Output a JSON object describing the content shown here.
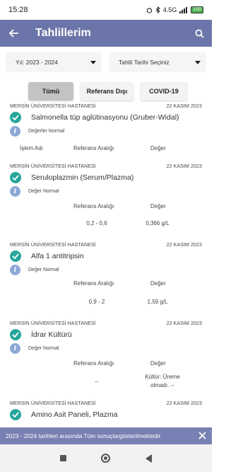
{
  "status_bar": {
    "time": "15:28",
    "network": "4.5G",
    "battery": "100"
  },
  "app_bar": {
    "title": "Tahlillerim"
  },
  "filters": {
    "year": "Yıl: 2023 - 2024",
    "date_placeholder": "Tahlil Tarihi Seçiniz"
  },
  "tabs": [
    {
      "label": "Tümü"
    },
    {
      "label": "Referans Dışı"
    },
    {
      "label": "COVID-19"
    }
  ],
  "results": [
    {
      "hospital": "MERSİN ÜNİVERSİTESİ HASTANESİ",
      "date": "22 KASIM 2023",
      "name": "Salmonella tüp aglütinasyonu (Gruber-Widal)",
      "status": "Değerler Normal",
      "col_process": "İşlem Adı",
      "col_range": "Referans Aralığı",
      "col_value": "Değer"
    },
    {
      "hospital": "MERSİN ÜNİVERSİTESİ HASTANESİ",
      "date": "22 KASIM 2023",
      "name": "Seruloplazmin (Serum/Plazma)",
      "status": "Değer Normal",
      "col_range": "Referans Aralığı",
      "col_value": "Değer",
      "range": "0,2 - 0,6",
      "value": "0,366 g/L"
    },
    {
      "hospital": "MERSİN ÜNİVERSİTESİ HASTANESİ",
      "date": "22 KASIM 2023",
      "name": "Alfa 1 antitripsin",
      "status": "Değer Normal",
      "col_range": "Referans Aralığı",
      "col_value": "Değer",
      "range": "0,9 - 2",
      "value": "1,59 g/L"
    },
    {
      "hospital": "MERSİN ÜNİVERSİTESİ HASTANESİ",
      "date": "22 KASIM 2023",
      "name": "İdrar Kültürü",
      "status": "Değer Normal",
      "col_range": "Referans Aralığı",
      "col_value": "Değer",
      "range": "--",
      "value_line1": "Kültür: Üreme",
      "value_line2": "olmadı. --"
    },
    {
      "hospital": "MERSİN ÜNİVERSİTESİ HASTANESİ",
      "date": "22 KASIM 2023",
      "name": "Amino Asit Paneli, Plazma"
    }
  ],
  "snackbar": {
    "message": "2023 - 2024 tarihleri arasında Tüm sonuçlargösterilmektedir."
  },
  "colors": {
    "app_bar": "#6c75a9",
    "check": "#26a69a",
    "info": "#8ea8d6",
    "snackbar": "#7980b3"
  }
}
